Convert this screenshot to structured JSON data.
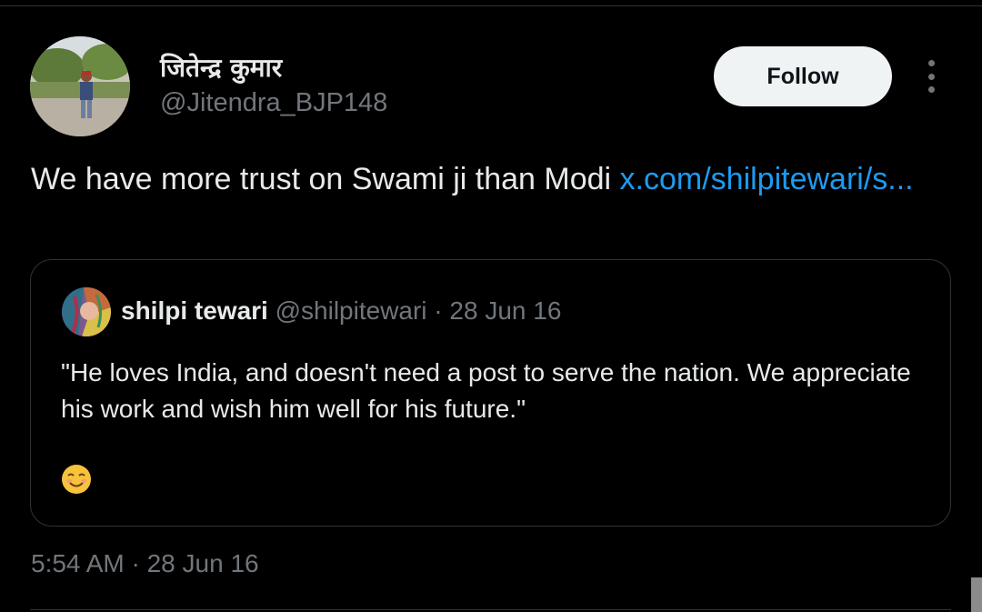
{
  "tweet": {
    "author_name": "जितेन्द्र कुमार",
    "author_handle": "@Jitendra_BJP148",
    "follow_label": "Follow",
    "text": "We have more trust on Swami ji than Modi ",
    "link_text": "x.com/shilpitewari/s...",
    "timestamp": "5:54 AM · 28 Jun 16"
  },
  "quote": {
    "author_name": "shilpi tewari",
    "author_handle": "@shilpitewari",
    "date": " · 28 Jun 16",
    "text": "\"He loves India, and doesn't need a post to serve the nation. We appreciate his work and wish him well for his future.\"",
    "emoji": "smiling-face-emoji"
  },
  "colors": {
    "background": "#000000",
    "text": "#e7e9ea",
    "muted": "#71767b",
    "link": "#1d9bf0",
    "border": "#2f3336",
    "follow_bg": "#eff3f4"
  },
  "icons": {
    "more": "more-vertical-icon"
  }
}
